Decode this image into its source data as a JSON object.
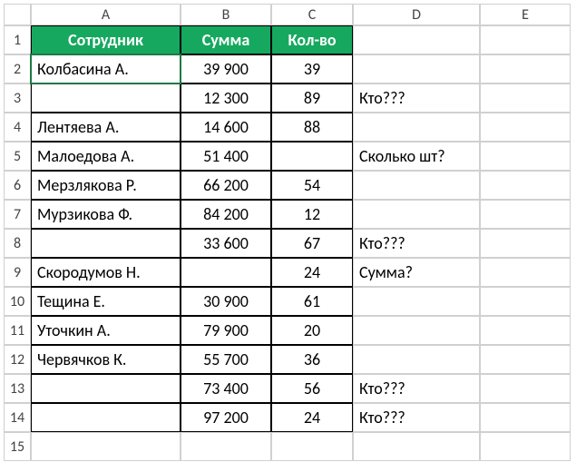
{
  "columns": [
    "A",
    "B",
    "C",
    "D",
    "E"
  ],
  "rowCount": 15,
  "selectedCell": "A2",
  "headers": {
    "a": "Сотрудник",
    "b": "Сумма",
    "c": "Кол-во"
  },
  "rows": [
    {
      "a": "Колбасина А.",
      "b": "39 900",
      "c": "39",
      "d": ""
    },
    {
      "a": "",
      "b": "12 300",
      "c": "89",
      "d": "Кто???"
    },
    {
      "a": "Лентяева А.",
      "b": "14 600",
      "c": "88",
      "d": ""
    },
    {
      "a": "Малоедова А.",
      "b": "51 400",
      "c": "",
      "d": "Сколько шт?"
    },
    {
      "a": "Мерзлякова Р.",
      "b": "66 200",
      "c": "54",
      "d": ""
    },
    {
      "a": "Мурзикова Ф.",
      "b": "84 200",
      "c": "12",
      "d": ""
    },
    {
      "a": "",
      "b": "33 600",
      "c": "67",
      "d": "Кто???"
    },
    {
      "a": "Скородумов Н.",
      "b": "",
      "c": "24",
      "d": "Сумма?"
    },
    {
      "a": "Тещина Е.",
      "b": "30 900",
      "c": "61",
      "d": ""
    },
    {
      "a": "Уточкин А.",
      "b": "79 900",
      "c": "20",
      "d": ""
    },
    {
      "a": "Червячков К.",
      "b": "55 700",
      "c": "36",
      "d": ""
    },
    {
      "a": "",
      "b": "73 400",
      "c": "56",
      "d": "Кто???"
    },
    {
      "a": "",
      "b": "97 200",
      "c": "24",
      "d": "Кто???"
    }
  ]
}
